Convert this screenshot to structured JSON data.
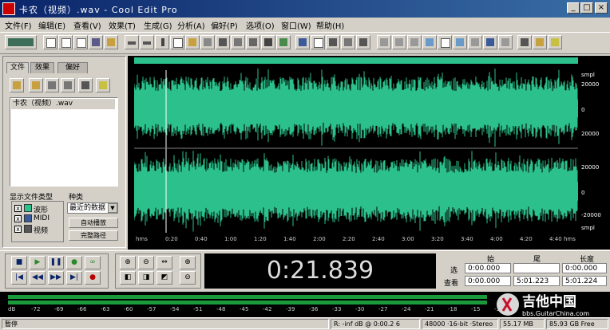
{
  "window": {
    "title": "卡农（视频）.wav - Cool Edit Pro",
    "minimize": "_",
    "maximize": "□",
    "close": "×"
  },
  "menu": [
    "文件(F)",
    "编辑(E)",
    "查看(V)",
    "效果(T)",
    "生成(G)",
    "分析(A)",
    "偏好(P)",
    "选项(O)",
    "窗口(W)",
    "帮助(H)"
  ],
  "left_panel": {
    "tabs": [
      "文件",
      "效果",
      "偏好"
    ],
    "file_item": "卡农（视频）.wav",
    "show_types_label": "显示文件类型",
    "types": [
      "波形",
      "MIDI",
      "视频"
    ],
    "sort_label": "种类",
    "sort_value": "最近的数据",
    "auto_play": "自动播放",
    "full_path": "完整路径"
  },
  "waveform": {
    "color": "#2cc08c",
    "top_scale": [
      "smpl",
      "20000",
      "0",
      "20000"
    ],
    "bottom_scale": [
      "20000",
      "0",
      "-20000",
      "smpl"
    ],
    "time_ruler": [
      "hms",
      "0:20",
      "0:40",
      "1:00",
      "1:20",
      "1:40",
      "2:00",
      "2:20",
      "2:40",
      "3:00",
      "3:20",
      "3:40",
      "4:00",
      "4:20",
      "4:40",
      "hms"
    ]
  },
  "transport": {
    "time": "0:21.839"
  },
  "selection": {
    "headers": [
      "始",
      "尾",
      "长度"
    ],
    "row1_label": "选",
    "row1": [
      "0:00.000",
      "",
      "0:00.000"
    ],
    "row2_label": "查看",
    "row2": [
      "0:00.000",
      "5:01.223",
      "5:01.224"
    ]
  },
  "meter": {
    "ticks": [
      "dB",
      "-72",
      "-69",
      "-66",
      "-63",
      "-60",
      "-57",
      "-54",
      "-51",
      "-48",
      "-45",
      "-42",
      "-39",
      "-36",
      "-33",
      "-30",
      "-27",
      "-24",
      "-21",
      "-18",
      "-15",
      "-12"
    ],
    "watermark": "吉他中国",
    "watermark_url": "bbs.GuitarChina.com"
  },
  "status": {
    "left": "暂停",
    "cursor": "R: -inf dB @ 0:00.2 6",
    "format": "48000 ·16-bit ·Stereo",
    "size": "55.17 MB",
    "free": "85.93 GB Free"
  }
}
